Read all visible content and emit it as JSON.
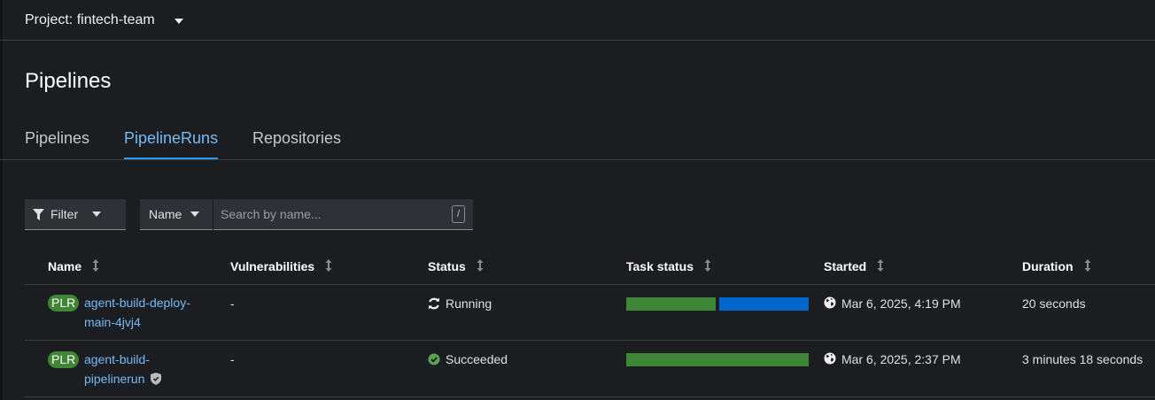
{
  "project_bar": {
    "label": "Project: fintech-team"
  },
  "page_title": "Pipelines",
  "tabs": [
    {
      "label": "Pipelines",
      "active": false
    },
    {
      "label": "PipelineRuns",
      "active": true
    },
    {
      "label": "Repositories",
      "active": false
    }
  ],
  "toolbar": {
    "filter_label": "Filter",
    "attribute_label": "Name",
    "search_placeholder": "Search by name...",
    "shortcut_key": "/"
  },
  "table": {
    "columns": [
      "Name",
      "Vulnerabilities",
      "Status",
      "Task status",
      "Started",
      "Duration"
    ],
    "rows": [
      {
        "badge": "PLR",
        "name": "agent-build-deploy-main-4jvj4",
        "vulnerabilities": "-",
        "status": "Running",
        "status_icon": "sync-icon",
        "task_status": {
          "succeeded": 1,
          "running": 1
        },
        "started": "Mar 6, 2025, 4:19 PM",
        "duration": "20 seconds",
        "signed": false
      },
      {
        "badge": "PLR",
        "name": "agent-build-pipelinerun",
        "vulnerabilities": "-",
        "status": "Succeeded",
        "status_icon": "check-circle-icon",
        "task_status": {
          "succeeded": 1,
          "running": 0
        },
        "started": "Mar 6, 2025, 2:37 PM",
        "duration": "3 minutes 18 seconds",
        "signed": true
      }
    ]
  },
  "colors": {
    "accent_link": "#73bcf7",
    "tab_underline": "#2b9af3",
    "success": "#3e8635",
    "running": "#0066cc",
    "badge_bg": "#3e8635"
  }
}
